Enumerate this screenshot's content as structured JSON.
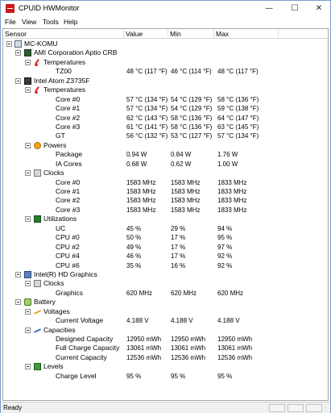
{
  "window": {
    "title": "CPUID HWMonitor",
    "minimize": "—",
    "maximize": "☐",
    "close": "✕"
  },
  "menu": [
    "File",
    "View",
    "Tools",
    "Help"
  ],
  "columns": {
    "sensor": "Sensor",
    "value": "Value",
    "min": "Min",
    "max": "Max"
  },
  "rows": [
    {
      "level": 0,
      "icon": "computer-icon",
      "label": "MC-KOMU",
      "expander": true
    },
    {
      "level": 1,
      "icon": "motherboard-icon",
      "label": "AMI Corporation Aptio CRB",
      "expander": true
    },
    {
      "level": 2,
      "icon": "thermometer-icon",
      "label": "Temperatures",
      "expander": true
    },
    {
      "level": 3,
      "label": "TZ00",
      "value": "48 °C  (117 °F)",
      "min": "46 °C  (114 °F)",
      "max": "48 °C  (117 °F)"
    },
    {
      "level": 1,
      "icon": "cpu-chip-icon",
      "label": "Intel Atom Z3735F",
      "expander": true
    },
    {
      "level": 2,
      "icon": "thermometer-icon",
      "label": "Temperatures",
      "expander": true
    },
    {
      "level": 3,
      "label": "Core #0",
      "value": "57 °C  (134 °F)",
      "min": "54 °C  (129 °F)",
      "max": "58 °C  (136 °F)"
    },
    {
      "level": 3,
      "label": "Core #1",
      "value": "57 °C  (134 °F)",
      "min": "54 °C  (129 °F)",
      "max": "59 °C  (138 °F)"
    },
    {
      "level": 3,
      "label": "Core #2",
      "value": "62 °C  (143 °F)",
      "min": "58 °C  (136 °F)",
      "max": "64 °C  (147 °F)"
    },
    {
      "level": 3,
      "label": "Core #3",
      "value": "61 °C  (141 °F)",
      "min": "58 °C  (136 °F)",
      "max": "63 °C  (145 °F)"
    },
    {
      "level": 3,
      "label": "GT",
      "value": "56 °C  (132 °F)",
      "min": "53 °C  (127 °F)",
      "max": "57 °C  (134 °F)"
    },
    {
      "level": 2,
      "icon": "power-icon",
      "label": "Powers",
      "expander": true
    },
    {
      "level": 3,
      "label": "Package",
      "value": "0.94 W",
      "min": "0.84 W",
      "max": "1.76 W"
    },
    {
      "level": 3,
      "label": "IA Cores",
      "value": "0.68 W",
      "min": "0.62 W",
      "max": "1.00 W"
    },
    {
      "level": 2,
      "icon": "clock-icon",
      "label": "Clocks",
      "expander": true
    },
    {
      "level": 3,
      "label": "Core #0",
      "value": "1583 MHz",
      "min": "1583 MHz",
      "max": "1833 MHz"
    },
    {
      "level": 3,
      "label": "Core #1",
      "value": "1583 MHz",
      "min": "1583 MHz",
      "max": "1833 MHz"
    },
    {
      "level": 3,
      "label": "Core #2",
      "value": "1583 MHz",
      "min": "1583 MHz",
      "max": "1833 MHz"
    },
    {
      "level": 3,
      "label": "Core #3",
      "value": "1583 MHz",
      "min": "1583 MHz",
      "max": "1833 MHz"
    },
    {
      "level": 2,
      "icon": "utilization-icon",
      "label": "Utilizations",
      "expander": true
    },
    {
      "level": 3,
      "label": "UC",
      "value": "45 %",
      "min": "29 %",
      "max": "94 %"
    },
    {
      "level": 3,
      "label": "CPU #0",
      "value": "50 %",
      "min": "17 %",
      "max": "95 %"
    },
    {
      "level": 3,
      "label": "CPU #2",
      "value": "49 %",
      "min": "17 %",
      "max": "97 %"
    },
    {
      "level": 3,
      "label": "CPU #4",
      "value": "46 %",
      "min": "17 %",
      "max": "92 %"
    },
    {
      "level": 3,
      "label": "CPU #6",
      "value": "35 %",
      "min": "16 %",
      "max": "92 %"
    },
    {
      "level": 1,
      "icon": "gpu-icon",
      "label": "Intel(R) HD Graphics",
      "expander": true
    },
    {
      "level": 2,
      "icon": "clock-icon",
      "label": "Clocks",
      "expander": true
    },
    {
      "level": 3,
      "label": "Graphics",
      "value": "620 MHz",
      "min": "620 MHz",
      "max": "620 MHz"
    },
    {
      "level": 1,
      "icon": "battery-icon",
      "label": "Battery",
      "expander": true
    },
    {
      "level": 2,
      "icon": "voltage-icon",
      "label": "Voltages",
      "expander": true
    },
    {
      "level": 3,
      "label": "Current Voltage",
      "value": "4.188 V",
      "min": "4.188 V",
      "max": "4.188 V"
    },
    {
      "level": 2,
      "icon": "capacity-icon",
      "label": "Capacities",
      "expander": true
    },
    {
      "level": 3,
      "label": "Designed Capacity",
      "value": "12950 mWh",
      "min": "12950 mWh",
      "max": "12950 mWh"
    },
    {
      "level": 3,
      "label": "Full Charge Capacity",
      "value": "13061 mWh",
      "min": "13061 mWh",
      "max": "13061 mWh"
    },
    {
      "level": 3,
      "label": "Current Capacity",
      "value": "12536 mWh",
      "min": "12536 mWh",
      "max": "12536 mWh"
    },
    {
      "level": 2,
      "icon": "level-icon",
      "label": "Levels",
      "expander": true
    },
    {
      "level": 3,
      "label": "Charge Level",
      "value": "95 %",
      "min": "95 %",
      "max": "95 %"
    }
  ],
  "status": {
    "text": "Ready"
  }
}
